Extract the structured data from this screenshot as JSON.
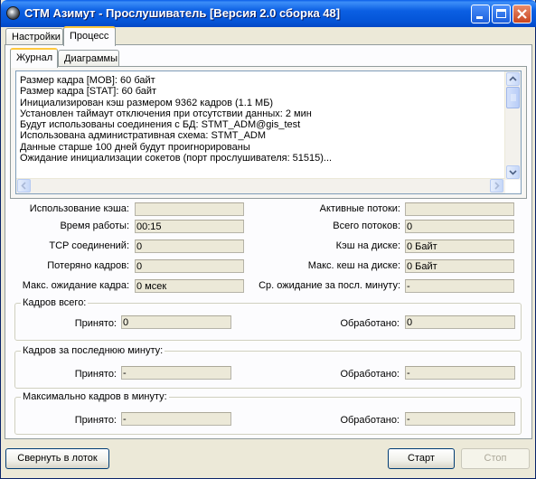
{
  "window": {
    "title": "СТМ Азимут - Прослушиватель [Версия 2.0 сборка 48]"
  },
  "tabs": {
    "top": [
      {
        "label": "Настройки"
      },
      {
        "label": "Процесс"
      }
    ],
    "sub": [
      {
        "label": "Журнал"
      },
      {
        "label": "Диаграммы"
      }
    ]
  },
  "log": {
    "lines": [
      "Размер кадра [MOB]: 60 байт",
      "Размер кадра [STAT]: 60 байт",
      "Инициализирован кэш размером 9362 кадров (1.1 МБ)",
      "Установлен таймаут отключения при отсутствии данных: 2 мин",
      "Будут использованы соединения с БД: STMT_ADM@gis_test",
      "Использована административная схема: STMT_ADM",
      "Данные старше 100 дней будут проигнорированы",
      "Ожидание инициализации сокетов (порт прослушивателя: 51515)..."
    ]
  },
  "stats": {
    "left": [
      {
        "label": "Использование кэша:",
        "value": ""
      },
      {
        "label": "Время работы:",
        "value": "00:15"
      },
      {
        "label": "TCP соединений:",
        "value": "0"
      },
      {
        "label": "Потеряно кадров:",
        "value": "0"
      },
      {
        "label": "Макс. ожидание кадра:",
        "value": "0 мсек"
      }
    ],
    "right": [
      {
        "label": "Активные потоки:",
        "value": ""
      },
      {
        "label": "Всего потоков:",
        "value": "0"
      },
      {
        "label": "Кэш на диске:",
        "value": "0 Байт"
      },
      {
        "label": "Макс. кеш на диске:",
        "value": "0 Байт"
      },
      {
        "label": "Ср. ожидание за посл. минуту:",
        "value": "-"
      }
    ]
  },
  "groups": [
    {
      "title": "Кадров всего:",
      "received_label": "Принято:",
      "received": "0",
      "processed_label": "Обработано:",
      "processed": "0"
    },
    {
      "title": "Кадров за последнюю минуту:",
      "received_label": "Принято:",
      "received": "-",
      "processed_label": "Обработано:",
      "processed": "-"
    },
    {
      "title": "Максимально кадров в минуту:",
      "received_label": "Принято:",
      "received": "-",
      "processed_label": "Обработано:",
      "processed": "-"
    }
  ],
  "buttons": {
    "minimize": "Свернуть в лоток",
    "start": "Старт",
    "stop": "Стоп"
  }
}
